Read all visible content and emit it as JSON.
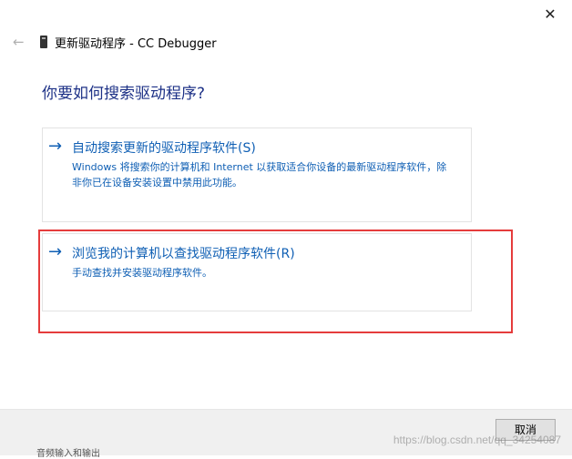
{
  "window": {
    "close_glyph": "✕",
    "title": "更新驱动程序 - CC Debugger"
  },
  "main": {
    "question": "你要如何搜索驱动程序?",
    "options": [
      {
        "arrow": "→",
        "title": "自动搜索更新的驱动程序软件(S)",
        "description": "Windows 将搜索你的计算机和 Internet 以获取适合你设备的最新驱动程序软件，除非你已在设备安装设置中禁用此功能。"
      },
      {
        "arrow": "→",
        "title": "浏览我的计算机以查找驱动程序软件(R)",
        "description": "手动查找并安装驱动程序软件。"
      }
    ]
  },
  "footer": {
    "cancel_label": "取消",
    "watermark": "https://blog.csdn.net/qq_34254087"
  },
  "background": {
    "peek_text": "音频输入和输出"
  },
  "colors": {
    "accent": "#0f5fb4",
    "heading": "#1e3287",
    "highlight": "#e53c3c"
  },
  "icons": {
    "back": "arrow-left-icon",
    "device": "usb-device-icon",
    "close": "close-icon"
  }
}
